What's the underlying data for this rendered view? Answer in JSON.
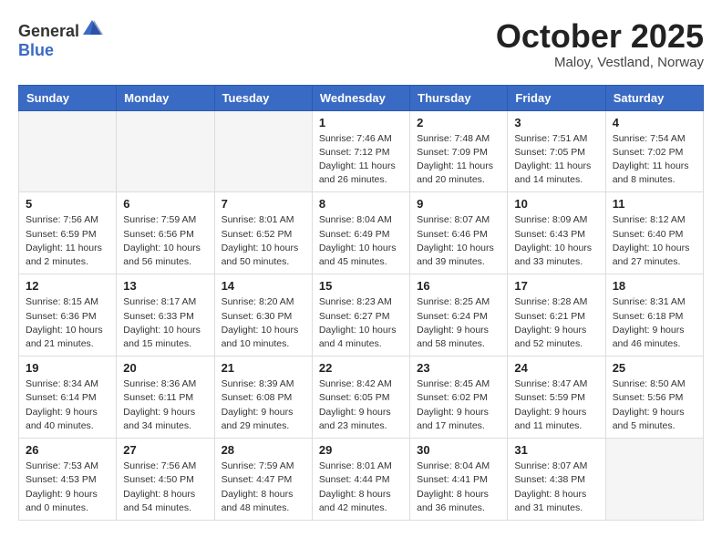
{
  "header": {
    "logo_general": "General",
    "logo_blue": "Blue",
    "month_title": "October 2025",
    "location": "Maloy, Vestland, Norway"
  },
  "days_of_week": [
    "Sunday",
    "Monday",
    "Tuesday",
    "Wednesday",
    "Thursday",
    "Friday",
    "Saturday"
  ],
  "weeks": [
    [
      {
        "day": "",
        "info": ""
      },
      {
        "day": "",
        "info": ""
      },
      {
        "day": "",
        "info": ""
      },
      {
        "day": "1",
        "info": "Sunrise: 7:46 AM\nSunset: 7:12 PM\nDaylight: 11 hours\nand 26 minutes."
      },
      {
        "day": "2",
        "info": "Sunrise: 7:48 AM\nSunset: 7:09 PM\nDaylight: 11 hours\nand 20 minutes."
      },
      {
        "day": "3",
        "info": "Sunrise: 7:51 AM\nSunset: 7:05 PM\nDaylight: 11 hours\nand 14 minutes."
      },
      {
        "day": "4",
        "info": "Sunrise: 7:54 AM\nSunset: 7:02 PM\nDaylight: 11 hours\nand 8 minutes."
      }
    ],
    [
      {
        "day": "5",
        "info": "Sunrise: 7:56 AM\nSunset: 6:59 PM\nDaylight: 11 hours\nand 2 minutes."
      },
      {
        "day": "6",
        "info": "Sunrise: 7:59 AM\nSunset: 6:56 PM\nDaylight: 10 hours\nand 56 minutes."
      },
      {
        "day": "7",
        "info": "Sunrise: 8:01 AM\nSunset: 6:52 PM\nDaylight: 10 hours\nand 50 minutes."
      },
      {
        "day": "8",
        "info": "Sunrise: 8:04 AM\nSunset: 6:49 PM\nDaylight: 10 hours\nand 45 minutes."
      },
      {
        "day": "9",
        "info": "Sunrise: 8:07 AM\nSunset: 6:46 PM\nDaylight: 10 hours\nand 39 minutes."
      },
      {
        "day": "10",
        "info": "Sunrise: 8:09 AM\nSunset: 6:43 PM\nDaylight: 10 hours\nand 33 minutes."
      },
      {
        "day": "11",
        "info": "Sunrise: 8:12 AM\nSunset: 6:40 PM\nDaylight: 10 hours\nand 27 minutes."
      }
    ],
    [
      {
        "day": "12",
        "info": "Sunrise: 8:15 AM\nSunset: 6:36 PM\nDaylight: 10 hours\nand 21 minutes."
      },
      {
        "day": "13",
        "info": "Sunrise: 8:17 AM\nSunset: 6:33 PM\nDaylight: 10 hours\nand 15 minutes."
      },
      {
        "day": "14",
        "info": "Sunrise: 8:20 AM\nSunset: 6:30 PM\nDaylight: 10 hours\nand 10 minutes."
      },
      {
        "day": "15",
        "info": "Sunrise: 8:23 AM\nSunset: 6:27 PM\nDaylight: 10 hours\nand 4 minutes."
      },
      {
        "day": "16",
        "info": "Sunrise: 8:25 AM\nSunset: 6:24 PM\nDaylight: 9 hours\nand 58 minutes."
      },
      {
        "day": "17",
        "info": "Sunrise: 8:28 AM\nSunset: 6:21 PM\nDaylight: 9 hours\nand 52 minutes."
      },
      {
        "day": "18",
        "info": "Sunrise: 8:31 AM\nSunset: 6:18 PM\nDaylight: 9 hours\nand 46 minutes."
      }
    ],
    [
      {
        "day": "19",
        "info": "Sunrise: 8:34 AM\nSunset: 6:14 PM\nDaylight: 9 hours\nand 40 minutes."
      },
      {
        "day": "20",
        "info": "Sunrise: 8:36 AM\nSunset: 6:11 PM\nDaylight: 9 hours\nand 34 minutes."
      },
      {
        "day": "21",
        "info": "Sunrise: 8:39 AM\nSunset: 6:08 PM\nDaylight: 9 hours\nand 29 minutes."
      },
      {
        "day": "22",
        "info": "Sunrise: 8:42 AM\nSunset: 6:05 PM\nDaylight: 9 hours\nand 23 minutes."
      },
      {
        "day": "23",
        "info": "Sunrise: 8:45 AM\nSunset: 6:02 PM\nDaylight: 9 hours\nand 17 minutes."
      },
      {
        "day": "24",
        "info": "Sunrise: 8:47 AM\nSunset: 5:59 PM\nDaylight: 9 hours\nand 11 minutes."
      },
      {
        "day": "25",
        "info": "Sunrise: 8:50 AM\nSunset: 5:56 PM\nDaylight: 9 hours\nand 5 minutes."
      }
    ],
    [
      {
        "day": "26",
        "info": "Sunrise: 7:53 AM\nSunset: 4:53 PM\nDaylight: 9 hours\nand 0 minutes."
      },
      {
        "day": "27",
        "info": "Sunrise: 7:56 AM\nSunset: 4:50 PM\nDaylight: 8 hours\nand 54 minutes."
      },
      {
        "day": "28",
        "info": "Sunrise: 7:59 AM\nSunset: 4:47 PM\nDaylight: 8 hours\nand 48 minutes."
      },
      {
        "day": "29",
        "info": "Sunrise: 8:01 AM\nSunset: 4:44 PM\nDaylight: 8 hours\nand 42 minutes."
      },
      {
        "day": "30",
        "info": "Sunrise: 8:04 AM\nSunset: 4:41 PM\nDaylight: 8 hours\nand 36 minutes."
      },
      {
        "day": "31",
        "info": "Sunrise: 8:07 AM\nSunset: 4:38 PM\nDaylight: 8 hours\nand 31 minutes."
      },
      {
        "day": "",
        "info": ""
      }
    ]
  ]
}
